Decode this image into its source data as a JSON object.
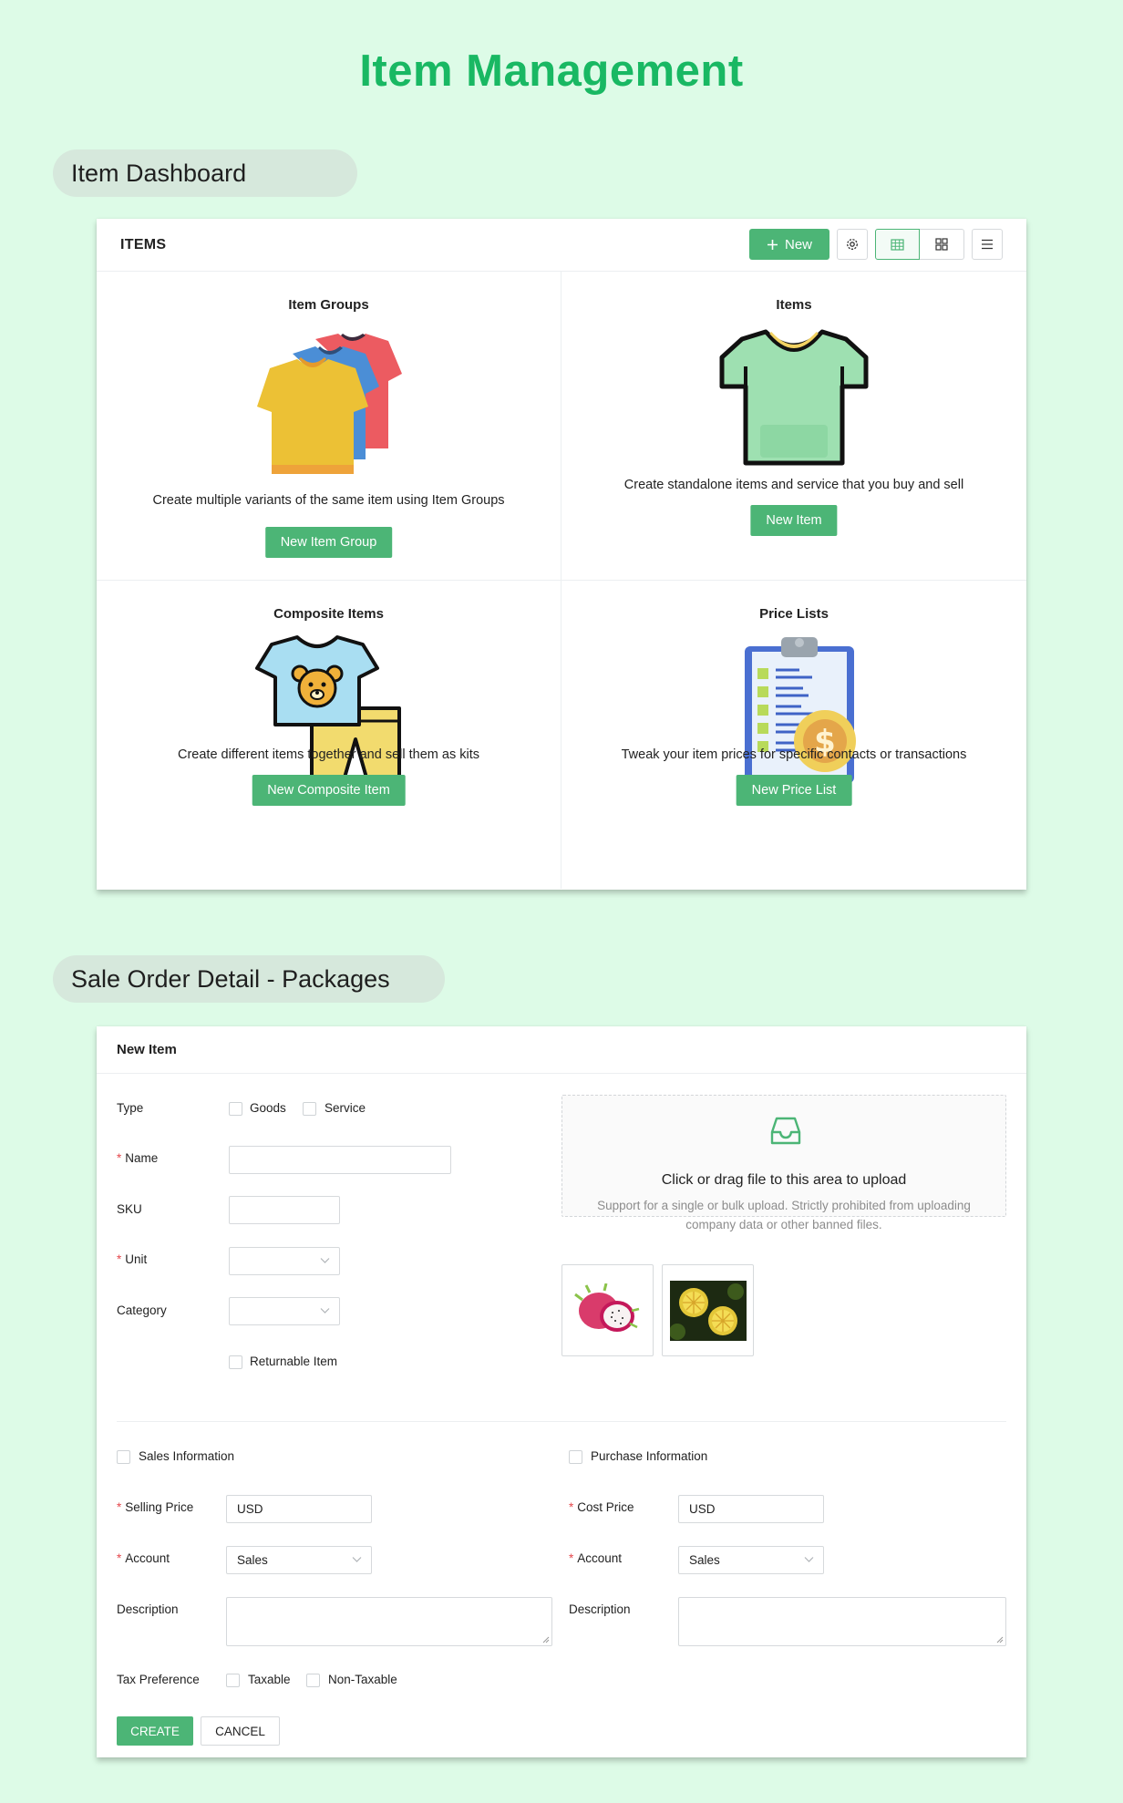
{
  "page": {
    "title": "Item Management"
  },
  "sections": {
    "dashboard_label": "Item Dashboard",
    "form_label": "Sale Order Detail - Packages"
  },
  "dashboard": {
    "title": "ITEMS",
    "new_button": "New",
    "toolbar_icons": [
      "gear-icon",
      "table-view-icon",
      "grid-view-icon",
      "menu-icon"
    ],
    "cards": [
      {
        "title": "Item Groups",
        "description": "Create multiple variants of the same item using Item Groups",
        "button": "New Item Group"
      },
      {
        "title": "Items",
        "description": "Create standalone items and service that you buy and sell",
        "button": "New Item"
      },
      {
        "title": "Composite Items",
        "description": "Create different items together and sell them as kits",
        "button": "New Composite Item"
      },
      {
        "title": "Price Lists",
        "description": "Tweak your item prices for specific contacts or transactions",
        "button": "New Price List"
      }
    ]
  },
  "form": {
    "title": "New Item",
    "type_label": "Type",
    "type_options": [
      "Goods",
      "Service"
    ],
    "name_label": "Name",
    "sku_label": "SKU",
    "unit_label": "Unit",
    "category_label": "Category",
    "returnable_label": "Returnable Item",
    "upload": {
      "title": "Click or drag file to this area to upload",
      "hint": "Support for a single or bulk upload. Strictly prohibited from uploading company data or other banned files."
    },
    "sales": {
      "heading": "Sales Information",
      "price_label": "Selling Price",
      "price_value": "USD",
      "account_label": "Account",
      "account_value": "Sales",
      "description_label": "Description"
    },
    "purchase": {
      "heading": "Purchase Information",
      "price_label": "Cost Price",
      "price_value": "USD",
      "account_label": "Account",
      "account_value": "Sales",
      "description_label": "Description"
    },
    "tax_label": "Tax Preference",
    "tax_options": [
      "Taxable",
      "Non-Taxable"
    ],
    "create_button": "CREATE",
    "cancel_button": "CANCEL"
  },
  "colors": {
    "background": "#ddfbe7",
    "title": "#19b863",
    "accent": "#4cb576",
    "required": "#e5484d"
  }
}
